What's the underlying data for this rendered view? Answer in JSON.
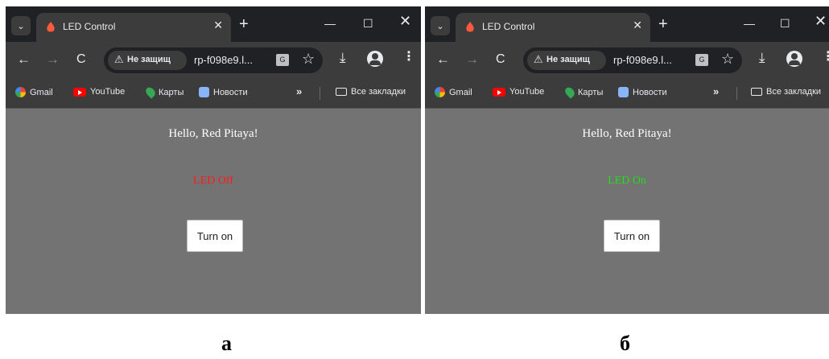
{
  "colors": {
    "led_off": "#ff1a1a",
    "led_on": "#22e01a",
    "content_bg": "#737373",
    "chrome_bg": "#3c3c3c"
  },
  "panels": [
    {
      "tab": {
        "title": "LED Control",
        "close": "✕"
      },
      "new_tab": "+",
      "window": {
        "minimize": "—",
        "maximize": "☐",
        "close": "✕"
      },
      "toolbar": {
        "back": "←",
        "forward": "→",
        "reload": "C",
        "security": "Не защищ",
        "url": "rp-f098e9.l...",
        "star": "☆",
        "download": "⤓",
        "menu": "⋮"
      },
      "bookmarks": {
        "gmail": "Gmail",
        "youtube": "YouTube",
        "maps": "Карты",
        "news": "Новости",
        "more": "»",
        "all": "Все закладки"
      },
      "page": {
        "hello": "Hello, Red Pitaya!",
        "led_status": "LED Off",
        "led_state": "off",
        "button": "Turn on"
      }
    },
    {
      "tab": {
        "title": "LED Control",
        "close": "✕"
      },
      "new_tab": "+",
      "window": {
        "minimize": "—",
        "maximize": "☐",
        "close": "✕"
      },
      "toolbar": {
        "back": "←",
        "forward": "→",
        "reload": "C",
        "security": "Не защищ",
        "url": "rp-f098e9.l...",
        "star": "☆",
        "download": "⤓",
        "menu": "⋮"
      },
      "bookmarks": {
        "gmail": "Gmail",
        "youtube": "YouTube",
        "maps": "Карты",
        "news": "Новости",
        "more": "»",
        "all": "Все закладки"
      },
      "page": {
        "hello": "Hello, Red Pitaya!",
        "led_status": "LED On",
        "led_state": "on",
        "button": "Turn on"
      }
    }
  ],
  "captions": {
    "a": "а",
    "b": "б"
  }
}
